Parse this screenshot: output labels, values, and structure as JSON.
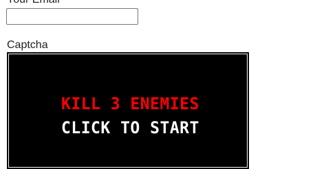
{
  "form": {
    "email_label": "Your Email",
    "email_value": "",
    "captcha_label": "Captcha"
  },
  "captcha_game": {
    "objective": "KILL 3 ENEMIES",
    "start_prompt": "CLICK TO START",
    "colors": {
      "background": "#000000",
      "objective_text": "#ff0000",
      "prompt_text": "#ffffff"
    }
  }
}
